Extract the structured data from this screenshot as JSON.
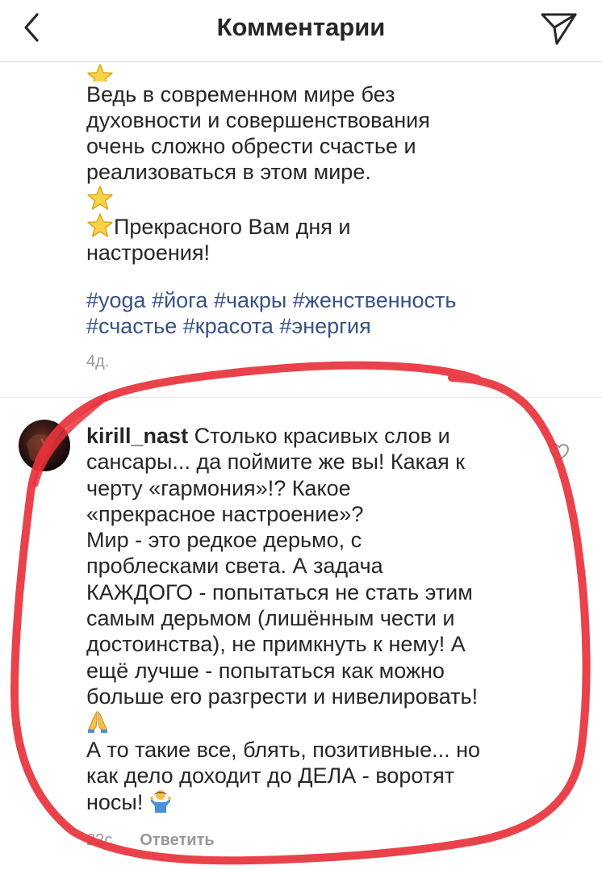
{
  "header": {
    "title": "Комментарии"
  },
  "post": {
    "caption_lines": [
      "Ведь в современном мире без",
      "духовности и совершенствования",
      "очень сложно обрести счастье и",
      "реализоваться в этом мире.",
      "",
      "Прекрасного Вам дня и",
      "настроения!"
    ],
    "hashtags_line1": "#yoga #йога #чакры #женственность",
    "hashtags_line2": "#счастье #красота #энергия",
    "time": "4д."
  },
  "comment": {
    "username": "kirill_nast",
    "lines": [
      " Столько красивых слов и",
      "сансары... да поймите же вы! Какая к",
      "черту «гармония»!? Какое",
      "«прекрасное настроение»?",
      "Мир - это редкое дерьмо, с",
      "проблесками света.   А задача",
      "КАЖДОГО - попытаться не стать этим",
      "самым дерьмом (лишённым чести и",
      "достоинства), не примкнуть к нему! А",
      "ещё лучше - попытаться как можно",
      "больше его разгрести и нивелировать!",
      "",
      "А то такие все, блять, позитивные... но",
      "как дело доходит до ДЕЛА - воротят",
      "носы! "
    ],
    "time": "22с",
    "reply_label": "Ответить"
  },
  "colors": {
    "hashtag": "#385185",
    "meta": "#999999",
    "annotation": "#e8323c"
  },
  "icons": {
    "back": "chevron-left-icon",
    "share": "paper-plane-icon",
    "like": "heart-icon"
  }
}
